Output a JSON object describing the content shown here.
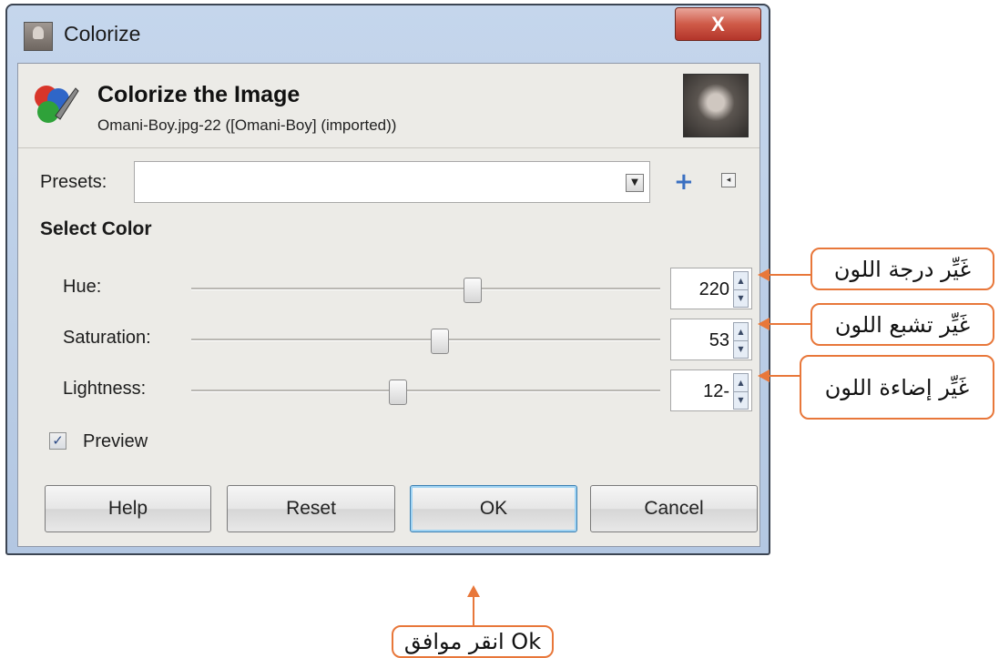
{
  "window": {
    "title": "Colorize",
    "close_glyph": "X"
  },
  "header": {
    "title": "Colorize the Image",
    "subtitle": "Omani-Boy.jpg-22 ([Omani-Boy] (imported))"
  },
  "presets": {
    "label": "Presets:",
    "value": ""
  },
  "section_title": "Select Color",
  "sliders": [
    {
      "label": "Hue:",
      "value": "220",
      "fraction": 0.6
    },
    {
      "label": "Saturation:",
      "value": "53",
      "fraction": 0.53
    },
    {
      "label": "Lightness:",
      "value": "12-",
      "fraction": 0.44
    }
  ],
  "preview": {
    "label": "Preview",
    "checked": true
  },
  "buttons": {
    "help": "Help",
    "reset": "Reset",
    "ok": "OK",
    "cancel": "Cancel"
  },
  "callouts": {
    "hue": "غَيِّر درجة اللون",
    "saturation": "غَيِّر تشبع اللون",
    "lightness": "غَيِّر إضاءة اللون",
    "ok": "انقر موافق Ok"
  },
  "colors": {
    "accent": "#e8773a",
    "dialog_bg": "#ecebe7",
    "frame": "#b3c7e2",
    "close": "#cf5a48"
  }
}
